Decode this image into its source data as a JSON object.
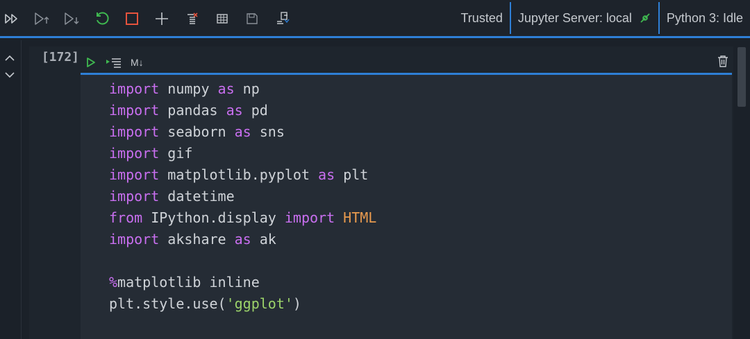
{
  "toolbar": {
    "buttons": [
      {
        "name": "run-all-icon"
      },
      {
        "name": "run-above-icon"
      },
      {
        "name": "run-below-icon"
      },
      {
        "name": "restart-kernel-icon"
      },
      {
        "name": "interrupt-kernel-icon"
      },
      {
        "name": "add-cell-icon"
      },
      {
        "name": "clear-outputs-icon"
      },
      {
        "name": "variables-icon"
      },
      {
        "name": "save-icon"
      },
      {
        "name": "export-icon"
      }
    ],
    "trusted_label": "Trusted",
    "server_label": "Jupyter Server: local",
    "kernel_label": "Python 3: Idle",
    "colors": {
      "accent": "#2e7fd6",
      "restart": "#3fb950",
      "interrupt": "#e5533d",
      "connected": "#3fb950"
    }
  },
  "cell": {
    "execution_count": "[172]",
    "toolbar": {
      "run_icon": "play-icon",
      "run_by_line_icon": "run-by-line-icon",
      "markdown_label": "M↓",
      "delete_icon": "trash-icon"
    },
    "code_lines": [
      [
        {
          "t": "import",
          "c": "kw"
        },
        {
          "t": " numpy ",
          "c": ""
        },
        {
          "t": "as",
          "c": "kw"
        },
        {
          "t": " np",
          "c": ""
        }
      ],
      [
        {
          "t": "import",
          "c": "kw"
        },
        {
          "t": " pandas ",
          "c": ""
        },
        {
          "t": "as",
          "c": "kw"
        },
        {
          "t": " pd",
          "c": ""
        }
      ],
      [
        {
          "t": "import",
          "c": "kw"
        },
        {
          "t": " seaborn ",
          "c": ""
        },
        {
          "t": "as",
          "c": "kw"
        },
        {
          "t": " sns",
          "c": ""
        }
      ],
      [
        {
          "t": "import",
          "c": "kw"
        },
        {
          "t": " gif",
          "c": ""
        }
      ],
      [
        {
          "t": "import",
          "c": "kw"
        },
        {
          "t": " matplotlib.pyplot ",
          "c": ""
        },
        {
          "t": "as",
          "c": "kw"
        },
        {
          "t": " plt",
          "c": ""
        }
      ],
      [
        {
          "t": "import",
          "c": "kw"
        },
        {
          "t": " datetime",
          "c": ""
        }
      ],
      [
        {
          "t": "from",
          "c": "kw"
        },
        {
          "t": " IPython.display ",
          "c": ""
        },
        {
          "t": "import",
          "c": "kw"
        },
        {
          "t": " ",
          "c": ""
        },
        {
          "t": "HTML",
          "c": "cls"
        }
      ],
      [
        {
          "t": "import",
          "c": "kw"
        },
        {
          "t": " akshare ",
          "c": ""
        },
        {
          "t": "as",
          "c": "kw"
        },
        {
          "t": " ak",
          "c": ""
        }
      ],
      [],
      [
        {
          "t": "%",
          "c": "kw"
        },
        {
          "t": "matplotlib inline",
          "c": ""
        }
      ],
      [
        {
          "t": "plt.style.use(",
          "c": ""
        },
        {
          "t": "'ggplot'",
          "c": "str"
        },
        {
          "t": ")",
          "c": ""
        }
      ]
    ]
  }
}
